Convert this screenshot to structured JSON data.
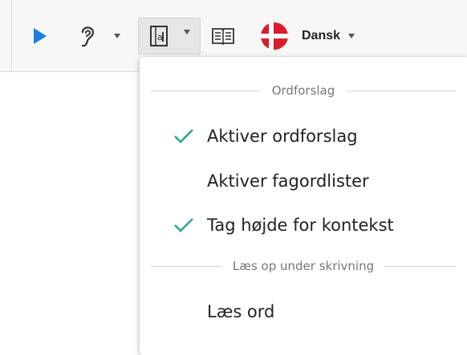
{
  "toolbar": {
    "play_icon": "play-icon",
    "ear_icon": "ear-icon",
    "prediction_icon": "word-prediction-icon",
    "book_icon": "book-icon",
    "flag_icon": "danish-flag-icon",
    "language_label": "Dansk",
    "colors": {
      "play": "#1a7fe0",
      "flag_red": "#d81e2c",
      "active_bg": "#e6e6e6"
    }
  },
  "menu": {
    "sections": [
      {
        "title": "Ordforslag",
        "items": [
          {
            "label": "Aktiver ordforslag",
            "checked": true
          },
          {
            "label": "Aktiver fagordlister",
            "checked": false
          },
          {
            "label": "Tag højde for kontekst",
            "checked": true
          }
        ]
      },
      {
        "title": "Læs op under skrivning",
        "items": [
          {
            "label": "Læs ord",
            "checked": false
          }
        ]
      }
    ],
    "check_color": "#2aa39a"
  }
}
